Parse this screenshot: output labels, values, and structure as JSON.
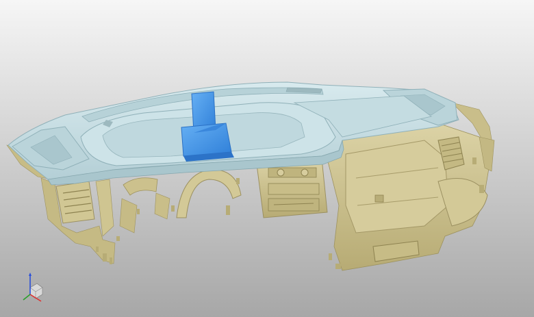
{
  "viewport": {
    "background_top": "#f6f6f6",
    "background_bottom": "#a7a7a7"
  },
  "model": {
    "scan_color": "#cfc596",
    "scan_shadow": "#968b59",
    "panel_color": "#c6dde2",
    "panel_edge": "#8fb0b8",
    "selection_color": "#4f9be8"
  },
  "triad": {
    "x_color": "#e03030",
    "y_color": "#28a028",
    "z_color": "#2a4fd8"
  }
}
